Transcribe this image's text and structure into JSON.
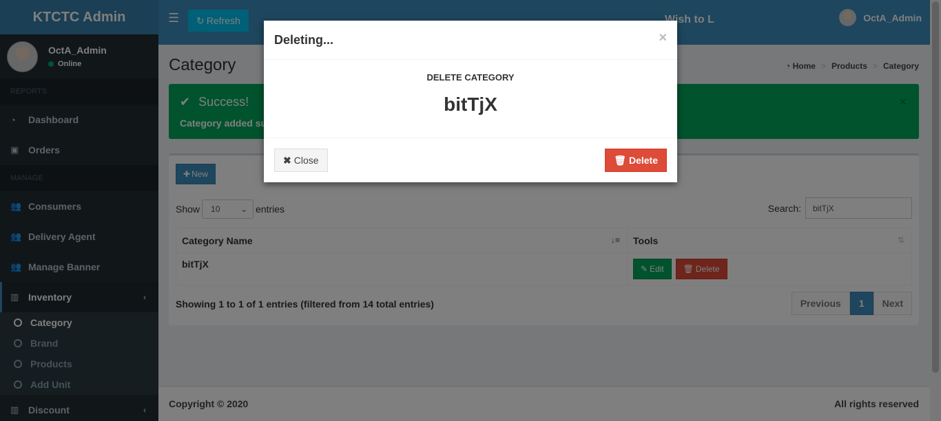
{
  "app": {
    "logo": "KTCTC Admin"
  },
  "user": {
    "name": "OctA_Admin",
    "status": "Online"
  },
  "sidebar": {
    "reports_header": "REPORTS",
    "manage_header": "MANAGE",
    "items": {
      "dashboard": "Dashboard",
      "orders": "Orders",
      "consumers": "Consumers",
      "delivery_agent": "Delivery Agent",
      "manage_banner": "Manage Banner",
      "inventory": "Inventory",
      "discount": "Discount"
    },
    "inventory_sub": {
      "category": "Category",
      "brand": "Brand",
      "products": "Products",
      "add_unit": "Add Unit"
    }
  },
  "navbar": {
    "refresh_label": "Refresh",
    "marquee": "Wish to L",
    "user_name": "OctA_Admin"
  },
  "page": {
    "title": "Category",
    "breadcrumb": {
      "home": "Home",
      "products": "Products",
      "category": "Category"
    }
  },
  "alert": {
    "title": "Success!",
    "message": "Category added successfully"
  },
  "box": {
    "new_label": "New",
    "show_label": "Show",
    "entries_label": "entries",
    "page_size": "10",
    "search_label": "Search:",
    "search_value": "bitTjX",
    "columns": {
      "name": "Category Name",
      "tools": "Tools"
    },
    "row": {
      "name": "bitTjX",
      "edit": "Edit",
      "delete": "Delete"
    },
    "info": "Showing 1 to 1 of 1 entries (filtered from 14 total entries)",
    "pager": {
      "prev": "Previous",
      "current": "1",
      "next": "Next"
    }
  },
  "footer": {
    "copyright": "Copyright © 2020",
    "rights": "All rights reserved"
  },
  "modal": {
    "title": "Deleting...",
    "subtitle": "DELETE CATEGORY",
    "item_name": "bitTjX",
    "close_label": "Close",
    "delete_label": "Delete"
  },
  "colors": {
    "primary": "#3c8dbc",
    "success": "#00a65a",
    "danger": "#dd4b39",
    "sidebar": "#222d32"
  }
}
